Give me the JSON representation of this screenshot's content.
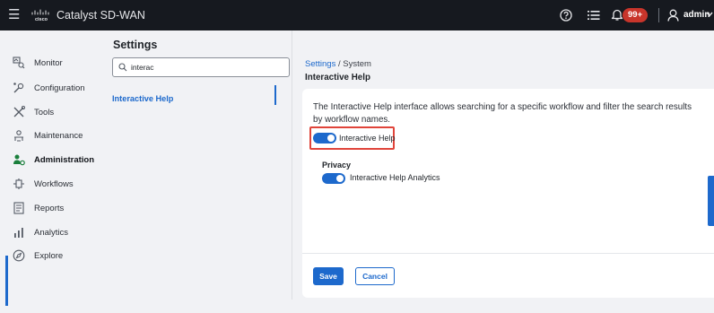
{
  "header": {
    "app_title": "Catalyst SD-WAN",
    "logo_text": "cisco",
    "notification_count": "99+",
    "user_name": "admin"
  },
  "sidebar": {
    "items": [
      {
        "label": "Monitor",
        "icon": "monitor-icon"
      },
      {
        "label": "Configuration",
        "icon": "configuration-icon"
      },
      {
        "label": "Tools",
        "icon": "tools-icon"
      },
      {
        "label": "Maintenance",
        "icon": "maintenance-icon"
      },
      {
        "label": "Administration",
        "icon": "administration-icon",
        "active": true
      },
      {
        "label": "Workflows",
        "icon": "workflows-icon"
      },
      {
        "label": "Reports",
        "icon": "reports-icon"
      },
      {
        "label": "Analytics",
        "icon": "analytics-icon"
      },
      {
        "label": "Explore",
        "icon": "explore-icon"
      }
    ]
  },
  "settings": {
    "title": "Settings",
    "search_value": "interac",
    "results": [
      {
        "label": "Interactive Help"
      }
    ]
  },
  "main": {
    "breadcrumb_root": "Settings",
    "breadcrumb_separator": " / ",
    "breadcrumb_current": "System",
    "section_title": "Interactive Help",
    "description": "The Interactive Help interface allows searching for a specific workflow and filter the search results by workflow names.",
    "toggle_interactive_help_label": "Interactive Help",
    "toggle_interactive_help_on": true,
    "privacy_title": "Privacy",
    "toggle_analytics_label": "Interactive Help Analytics",
    "toggle_analytics_on": true,
    "save_label": "Save",
    "cancel_label": "Cancel"
  },
  "colors": {
    "accent": "#1d69cc",
    "topbar": "#16191f",
    "highlight": "#e0443a",
    "badge": "#c8352b"
  }
}
